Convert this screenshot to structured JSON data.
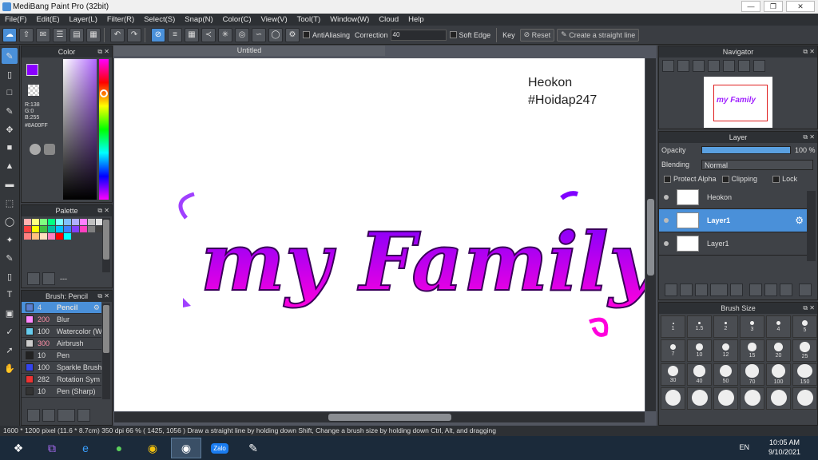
{
  "window": {
    "title": "MediBang Paint Pro (32bit)"
  },
  "menu": [
    "File(F)",
    "Edit(E)",
    "Layer(L)",
    "Filter(R)",
    "Select(S)",
    "Snap(N)",
    "Color(C)",
    "View(V)",
    "Tool(T)",
    "Window(W)",
    "Cloud",
    "Help"
  ],
  "toolbar": {
    "antialiasing_label": "AntiAliasing",
    "correction_label": "Correction",
    "correction_value": "40",
    "soft_edge_label": "Soft Edge",
    "key_label": "Key",
    "reset_label": "Reset",
    "straight_line_label": "Create a straight line"
  },
  "color_panel": {
    "title": "Color",
    "r": "R:138",
    "g": "G:0",
    "b": "B:255",
    "hex": "#8A00FF",
    "primary": "#8a00ff"
  },
  "palette_panel": {
    "title": "Palette",
    "dash": "---"
  },
  "brush_panel": {
    "title": "Brush: Pencil",
    "items": [
      {
        "size": "4",
        "name": "Pencil",
        "color": "#5a7fd0"
      },
      {
        "size": "200",
        "name": "Blur",
        "color": "#ff88ff"
      },
      {
        "size": "100",
        "name": "Watercolor (W",
        "color": "#66ccee"
      },
      {
        "size": "300",
        "name": "Airbrush",
        "color": "#cccccc"
      },
      {
        "size": "10",
        "name": "Pen",
        "color": "#222222"
      },
      {
        "size": "100",
        "name": "Sparkle Brush",
        "color": "#3344ee"
      },
      {
        "size": "282",
        "name": "Rotation Sym",
        "color": "#ee3333"
      },
      {
        "size": "10",
        "name": "Pen (Sharp)",
        "color": "#333333"
      }
    ]
  },
  "document": {
    "tab_title": "Untitled",
    "canvas_text_1": "Heokon",
    "canvas_text_2": "#Hoidap247",
    "artwork_text": "my Family"
  },
  "navigator": {
    "title": "Navigator",
    "thumb_text": "my Family"
  },
  "layer_panel": {
    "title": "Layer",
    "opacity_label": "Opacity",
    "opacity_value": "100 %",
    "blending_label": "Blending",
    "blending_value": "Normal",
    "protect_alpha_label": "Protect Alpha",
    "clipping_label": "Clipping",
    "lock_label": "Lock",
    "layers": [
      {
        "name": "Heokon",
        "selected": false
      },
      {
        "name": "Layer1",
        "selected": true
      },
      {
        "name": "Layer1",
        "selected": false
      }
    ]
  },
  "brush_size_panel": {
    "title": "Brush Size",
    "sizes": [
      "1",
      "1.5",
      "2",
      "3",
      "4",
      "5",
      "7",
      "10",
      "12",
      "15",
      "20",
      "25",
      "30",
      "40",
      "50",
      "70",
      "100",
      "150",
      "",
      "",
      "",
      "",
      "",
      ""
    ]
  },
  "status": {
    "text": "1600 * 1200 pixel   (11.6 * 8.7cm)   350 dpi   66 %   ( 1425, 1056 )   Draw a straight line by holding down Shift, Change a brush size by holding down Ctrl, Alt, and dragging"
  },
  "taskbar": {
    "lang": "EN",
    "time": "10:05 AM",
    "date": "9/10/2021",
    "zalo_label": "Zalo"
  }
}
